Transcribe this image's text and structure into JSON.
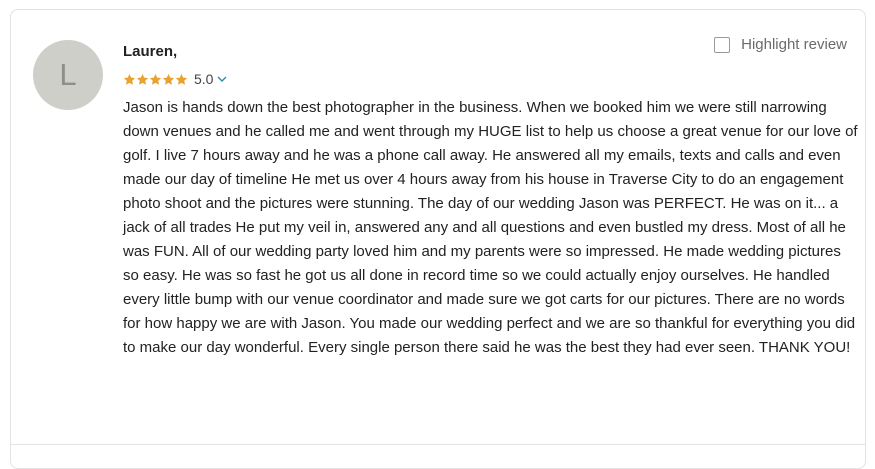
{
  "review": {
    "avatar_initial": "L",
    "author": "Lauren,",
    "rating": "5.0",
    "star_count": 5,
    "star_color": "#e8a22f",
    "accent_color": "#2a8fa6",
    "highlight_label": "Highlight review",
    "highlight_checked": false,
    "text": "Jason is hands down the best photographer in the business. When we booked him we were still narrowing down venues and he called me and went through my HUGE list to help us choose a great venue for our love of golf. I live 7 hours away and he was a phone call away. He answered all my emails, texts and calls and even made our day of timeline He met us over 4 hours away from his house in Traverse City to do an engagement photo shoot and the pictures were stunning. The day of our wedding Jason was PERFECT. He was on it... a jack of all trades He put my veil in, answered any and all questions and even bustled my dress. Most of all he was FUN. All of our wedding party loved him and my parents were so impressed. He made wedding pictures so easy. He was so fast he got us all done in record time so we could actually enjoy ourselves. He handled every little bump with our venue coordinator and made sure we got carts for our pictures. There are no words for how happy we are with Jason. You made our wedding perfect and we are so thankful for everything you did to make our day wonderful. Every single person there said he was the best they had ever seen. THANK YOU!"
  },
  "icons": {
    "star": "star-icon",
    "chevron": "chevron-down-icon",
    "checkbox": "checkbox-icon"
  }
}
